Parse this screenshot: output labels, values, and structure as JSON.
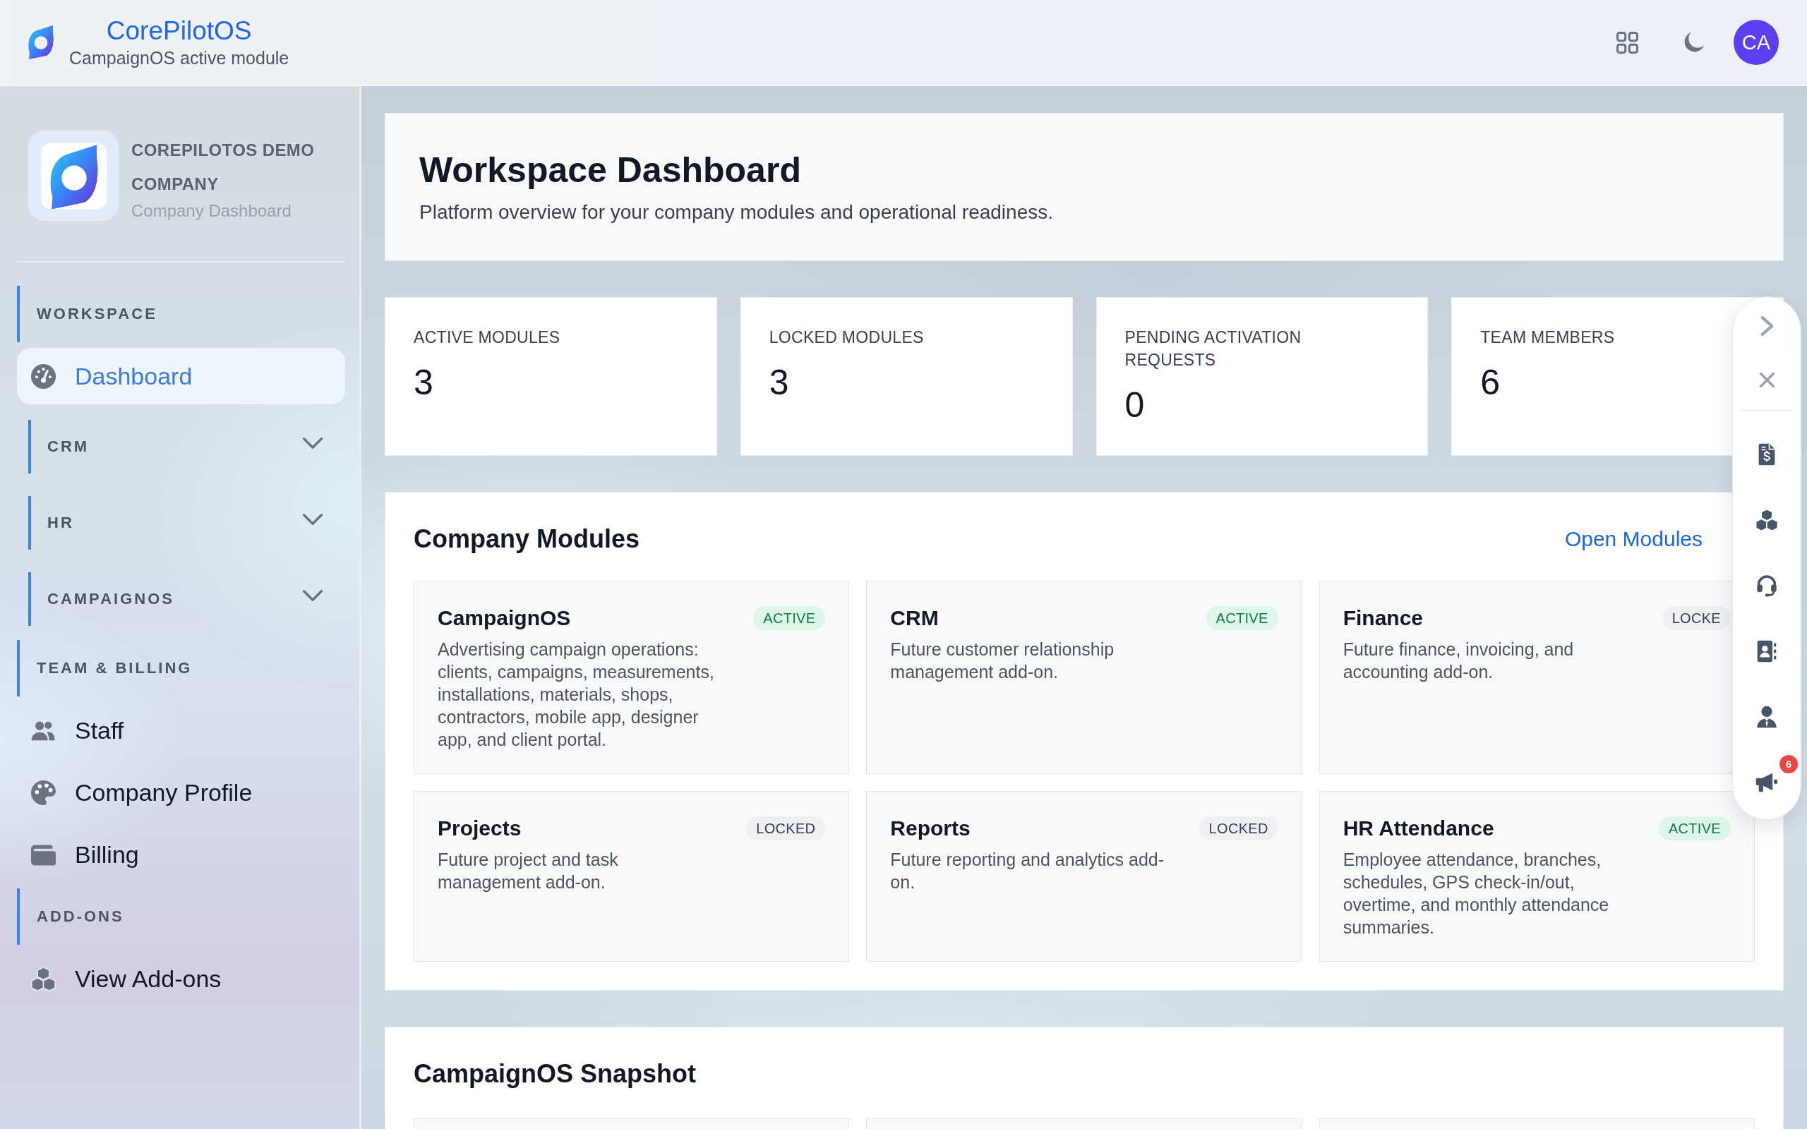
{
  "top_bar": {
    "brand": "CorePilotOS",
    "subtitle": "CampaignOS active module",
    "avatar": "CA"
  },
  "sidebar": {
    "company": {
      "name": "COREPILOTOS DEMO COMPANY",
      "subtitle": "Company Dashboard"
    },
    "nav": [
      {
        "kind": "heading",
        "label": "WORKSPACE"
      },
      {
        "kind": "item",
        "label": "Dashboard",
        "selected": true
      },
      {
        "kind": "group",
        "label": "CRM",
        "expanded": false
      },
      {
        "kind": "group",
        "label": "HR",
        "expanded": false
      },
      {
        "kind": "group",
        "label": "CAMPAIGNOS",
        "expanded": false
      },
      {
        "kind": "heading",
        "label": "TEAM & BILLING"
      },
      {
        "kind": "item",
        "label": "Staff",
        "selected": false
      },
      {
        "kind": "item",
        "label": "Company Profile",
        "selected": false
      },
      {
        "kind": "item",
        "label": "Billing",
        "selected": false
      },
      {
        "kind": "heading",
        "label": "ADD-ONS"
      },
      {
        "kind": "item",
        "label": "View Add-ons",
        "selected": false
      }
    ]
  },
  "page_header": {
    "title": "Workspace Dashboard",
    "subtitle": "Platform overview for your company modules and operational readiness."
  },
  "stats": [
    {
      "label": "ACTIVE MODULES",
      "value": "3"
    },
    {
      "label": "LOCKED MODULES",
      "value": "3"
    },
    {
      "label": "PENDING ACTIVATION REQUESTS",
      "value": "0"
    },
    {
      "label": "TEAM MEMBERS",
      "value": "6"
    }
  ],
  "company_modules": {
    "title": "Company Modules",
    "link": "Open Modules",
    "cards": [
      {
        "name": "CampaignOS",
        "status": "ACTIVE",
        "active": true,
        "description": "Advertising campaign operations: clients, campaigns, measurements, installations, materials, shops, contractors, mobile app, designer app, and client portal."
      },
      {
        "name": "CRM",
        "status": "ACTIVE",
        "active": true,
        "description": "Future customer relationship management add-on."
      },
      {
        "name": "Finance",
        "status": "LOCKE",
        "active": false,
        "description": "Future finance, invoicing, and accounting add-on."
      },
      {
        "name": "Projects",
        "status": "LOCKED",
        "active": false,
        "description": "Future project and task management add-on."
      },
      {
        "name": "Reports",
        "status": "LOCKED",
        "active": false,
        "description": "Future reporting and analytics add-on."
      },
      {
        "name": "HR Attendance",
        "status": "ACTIVE",
        "active": true,
        "description": "Employee attendance, branches, schedules, GPS check-in/out, overtime, and monthly attendance summaries."
      }
    ]
  },
  "snapshot": {
    "title": "CampaignOS Snapshot"
  },
  "quick_panel": {
    "badge_count": "6"
  }
}
